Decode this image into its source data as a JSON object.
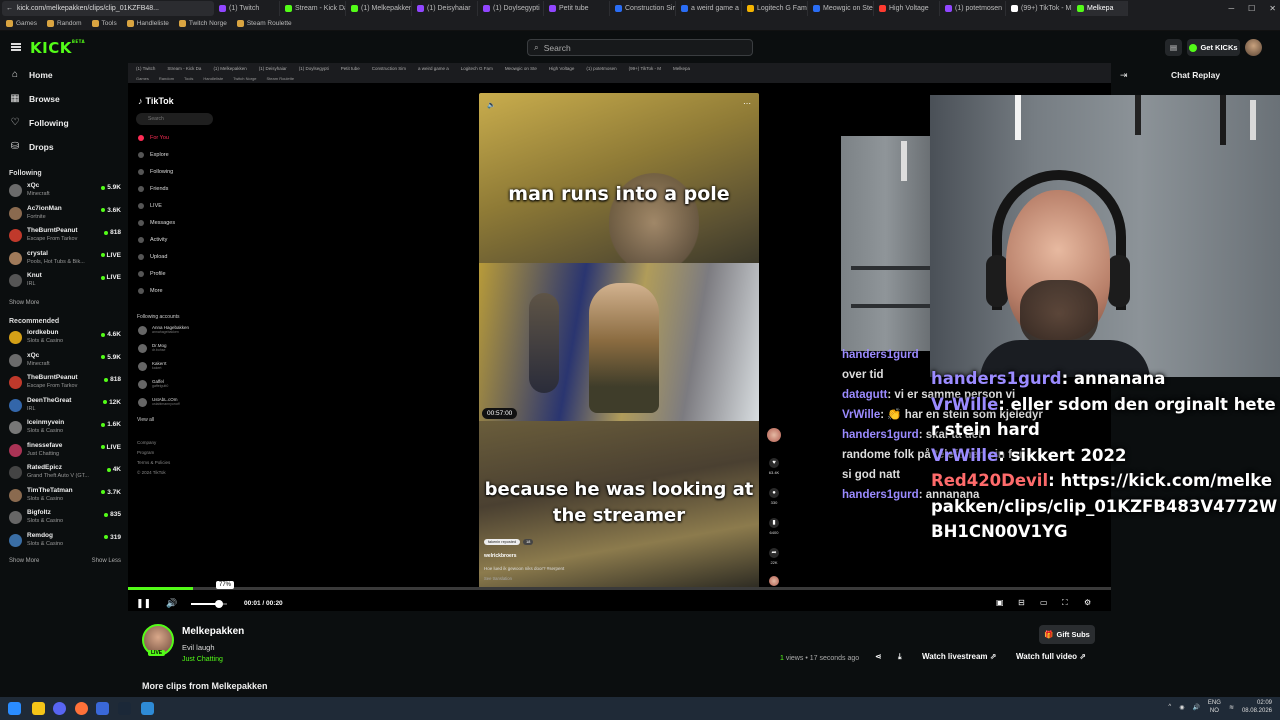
{
  "browser": {
    "url": "kick.com/melkepakken/clips/clip_01KZFB48...",
    "tabs": [
      {
        "label": "(1) Twitch",
        "color": "#9146ff"
      },
      {
        "label": "Stream - Kick Da",
        "color": "#53fc18"
      },
      {
        "label": "(1) Melkepakken",
        "color": "#53fc18"
      },
      {
        "label": "(1) Deisyhaiar",
        "color": "#9146ff"
      },
      {
        "label": "(1) Doylsegypti",
        "color": "#9146ff"
      },
      {
        "label": "Petit tube",
        "color": "#9146ff"
      },
      {
        "label": "Construction Sim",
        "color": "#2a6df4"
      },
      {
        "label": "a weird game a",
        "color": "#2a6df4"
      },
      {
        "label": "Logitech G Fam",
        "color": "#f4b400"
      },
      {
        "label": "Meowgic on Ste",
        "color": "#2a6df4"
      },
      {
        "label": "High Voltage",
        "color": "#ff3b30"
      },
      {
        "label": "(1) potetmosen",
        "color": "#9146ff"
      },
      {
        "label": "(99+) TikTok - M",
        "color": "#ffffff"
      },
      {
        "label": "Melkepa",
        "color": "#53fc18"
      }
    ],
    "bookmarks": [
      "Games",
      "Random",
      "Tools",
      "Handleliste",
      "Twitch Norge",
      "Steam Roulette"
    ]
  },
  "header": {
    "logo": "KICK",
    "logo_tag": "BETA",
    "search_placeholder": "Search",
    "get_kicks_label": "Get KICKs"
  },
  "sidebar": {
    "nav": [
      {
        "label": "Home",
        "icon": "home-icon"
      },
      {
        "label": "Browse",
        "icon": "browse-icon"
      },
      {
        "label": "Following",
        "icon": "heart-icon"
      },
      {
        "label": "Drops",
        "icon": "drops-icon"
      }
    ],
    "following_title": "Following",
    "following": [
      {
        "name": "xQc",
        "category": "Minecraft",
        "viewers": "5.9K",
        "color": "#6b6b6b"
      },
      {
        "name": "Ac7ionMan",
        "category": "Fortnite",
        "viewers": "3.6K",
        "color": "#8a6a4f"
      },
      {
        "name": "TheBurntPeanut",
        "category": "Escape From Tarkov",
        "viewers": "818",
        "color": "#c0392b"
      },
      {
        "name": "crystal",
        "category": "Pools, Hot Tubs & Bik...",
        "viewers": "LIVE",
        "color": "#a07a5a"
      },
      {
        "name": "Knut",
        "category": "IRL",
        "viewers": "LIVE",
        "color": "#555555"
      }
    ],
    "show_more": "Show More",
    "recommended_title": "Recommended",
    "recommended": [
      {
        "name": "lordkebun",
        "category": "Slots & Casino",
        "viewers": "4.6K",
        "color": "#d4a017"
      },
      {
        "name": "xQc",
        "category": "Minecraft",
        "viewers": "5.9K",
        "color": "#6b6b6b"
      },
      {
        "name": "TheBurntPeanut",
        "category": "Escape From Tarkov",
        "viewers": "818",
        "color": "#c0392b"
      },
      {
        "name": "DeenTheGreat",
        "category": "IRL",
        "viewers": "12K",
        "color": "#3366aa"
      },
      {
        "name": "Iceinmyvein",
        "category": "Slots & Casino",
        "viewers": "1.6K",
        "color": "#777777"
      },
      {
        "name": "finessefave",
        "category": "Just Chatting",
        "viewers": "LIVE",
        "color": "#aa3355"
      },
      {
        "name": "RatedEpicz",
        "category": "Grand Theft Auto V (GT...",
        "viewers": "4K",
        "color": "#444444"
      },
      {
        "name": "TimTheTatman",
        "category": "Slots & Casino",
        "viewers": "3.7K",
        "color": "#8a6a4f"
      },
      {
        "name": "Bigfoltz",
        "category": "Slots & Casino",
        "viewers": "835",
        "color": "#666666"
      },
      {
        "name": "Remdog",
        "category": "Slots & Casino",
        "viewers": "319",
        "color": "#3a6ea5"
      }
    ],
    "show_more_2": "Show More",
    "show_less": "Show Less"
  },
  "tiktok": {
    "logo": "TikTok",
    "search_placeholder": "Search",
    "nav": [
      "For You",
      "Explore",
      "Following",
      "Friends",
      "LIVE",
      "Messages",
      "Activity",
      "Upload",
      "Profile",
      "More"
    ],
    "following_accounts_title": "Following accounts",
    "accounts": [
      {
        "name": "Anna Hagebakken",
        "handle": "annahagebakken"
      },
      {
        "name": "Dr.Mog",
        "handle": "dr.bohse"
      },
      {
        "name": "Kakerrt",
        "handle": "kakert"
      },
      {
        "name": "Gaffel",
        "handle": "gaffelgutt0"
      },
      {
        "name": "UstAbL.cOm",
        "handle": "ustablmannyonoff"
      }
    ],
    "view_all": "View all",
    "footer": [
      "Company",
      "Program",
      "Terms & Policies",
      "© 2024 TikTok"
    ],
    "caption_top": "man runs into a pole",
    "caption_bottom": "because he was looking at the streamer",
    "video_time": "00:57:00",
    "reposted": "fakenin reposted",
    "reposted_count": "18",
    "author": "welrickbroers",
    "description": "Hoe lued ik gewoon niks door? #serpent",
    "see_translation": "See translation",
    "actions": [
      "63.4K",
      "330",
      "6400",
      "22K"
    ]
  },
  "chat_faint": [
    {
      "user": "handers1gurd",
      "text": ""
    },
    {
      "user": "",
      "text": "over tid"
    },
    {
      "user": "datagutt",
      "text": ": vi er samme person vi"
    },
    {
      "user": "VrWille",
      "text": ": 👏 har en stein som kjeledyr"
    },
    {
      "user": "handers1gurd",
      "text": ": skal ta det"
    },
    {
      "user": "",
      "text": "randome folk på telefonen sin for å"
    },
    {
      "user": "",
      "text": "si god natt"
    },
    {
      "user": "handers1gurd",
      "text": ": annanana"
    }
  ],
  "chat_big": [
    {
      "user": "handers1gurd",
      "text": ": annanana",
      "color": "#9b8bff"
    },
    {
      "user": "VrWille",
      "text": ": eller sdom den orginalt heter stein hard",
      "color": "#9b8bff"
    },
    {
      "user": "VrWille",
      "text": ": sikkert 2022",
      "color": "#9b8bff"
    },
    {
      "user": "Red420Devil",
      "text": ": https://kick.com/melkepakken/clips/clip_01KZFB483V4772WBH1CN00V1YG",
      "color": "#ff6b6b"
    }
  ],
  "chat_panel": {
    "title": "Chat Replay"
  },
  "player": {
    "progress": 0.066,
    "tooltip": "77%",
    "volume": 0.77,
    "time_current": "00:01",
    "time_total": "00:20"
  },
  "clip": {
    "channel": "Melkepakken",
    "title": "Evil laugh",
    "category": "Just Chatting",
    "live_badge": "LIVE",
    "views_count": "1",
    "views_label": "views",
    "age": "17 seconds ago",
    "gift_subs": "Gift Subs",
    "watch_livestream": "Watch livestream",
    "watch_full_video": "Watch full video",
    "more_clips": "More clips from Melkepakken"
  },
  "taskbar": {
    "lang_top": "ENG",
    "lang_bottom": "NO",
    "time": "02:09",
    "date": "08.08.2026"
  }
}
